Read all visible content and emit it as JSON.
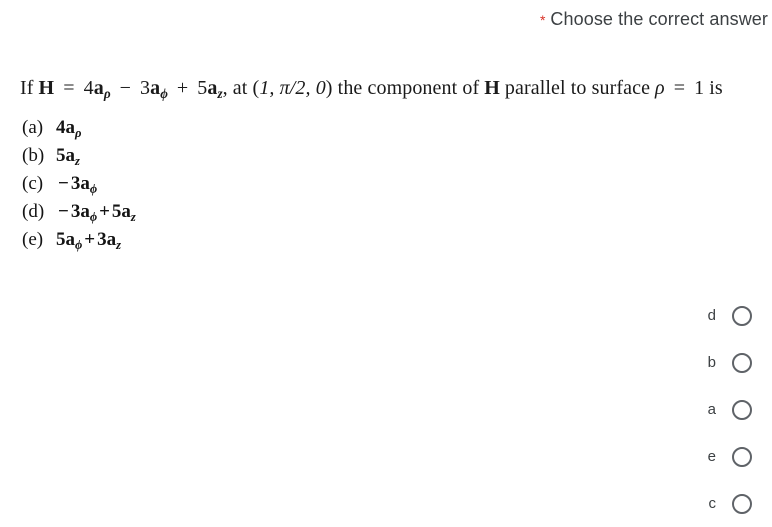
{
  "header": {
    "required_marker": "*",
    "title": "Choose the correct answer",
    "asterisk_color": "#d93025",
    "title_color": "#3c4043"
  },
  "question": {
    "stem": {
      "prefix": "If",
      "vector_H": "H",
      "equals": "=",
      "term1_coef": "4",
      "term1_vec": "a",
      "term1_sub": "ρ",
      "minus": "−",
      "term2_coef": "3",
      "term2_vec": "a",
      "term2_sub": "ϕ",
      "plus": "+",
      "term3_coef": "5",
      "term3_vec": "a",
      "term3_sub": "z",
      "comma_at": ", at (",
      "point": "1, π/2, 0",
      "mid_text": ") the component of",
      "vector_H2": "H",
      "tail_text": "parallel to surface",
      "rho": "ρ",
      "equals2": "=",
      "value": "1",
      "is": "is",
      "plain": "If H = 4aρ − 3aϕ + 5az, at (1, π/2, 0) the component of H parallel to surface ρ = 1 is"
    },
    "options": [
      {
        "letter": "(a)",
        "plain": "4aρ",
        "parts": [
          {
            "coef": "4",
            "vec": "a",
            "sub": "ρ",
            "sign": ""
          }
        ]
      },
      {
        "letter": "(b)",
        "plain": "5az",
        "parts": [
          {
            "coef": "5",
            "vec": "a",
            "sub": "z",
            "sign": ""
          }
        ]
      },
      {
        "letter": "(c)",
        "plain": "−3aϕ",
        "parts": [
          {
            "coef": "3",
            "vec": "a",
            "sub": "ϕ",
            "sign": "−"
          }
        ]
      },
      {
        "letter": "(d)",
        "plain": "−3aϕ + 5az",
        "parts": [
          {
            "coef": "3",
            "vec": "a",
            "sub": "ϕ",
            "sign": "−"
          },
          {
            "coef": "5",
            "vec": "a",
            "sub": "z",
            "sign": "+"
          }
        ]
      },
      {
        "letter": "(e)",
        "plain": "5aϕ + 3az",
        "parts": [
          {
            "coef": "5",
            "vec": "a",
            "sub": "ϕ",
            "sign": ""
          },
          {
            "coef": "3",
            "vec": "a",
            "sub": "z",
            "sign": "+"
          }
        ]
      }
    ]
  },
  "answers": {
    "selected": null,
    "options": [
      {
        "label": "d",
        "value": "d"
      },
      {
        "label": "b",
        "value": "b"
      },
      {
        "label": "a",
        "value": "a"
      },
      {
        "label": "e",
        "value": "e"
      },
      {
        "label": "c",
        "value": "c"
      }
    ]
  }
}
